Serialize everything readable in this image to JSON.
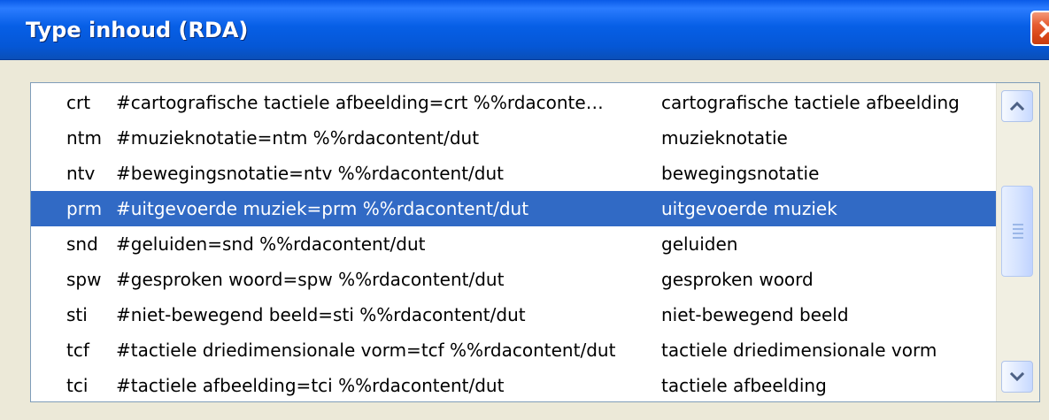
{
  "window": {
    "title": "Type inhoud (RDA)",
    "colors": {
      "titlebar": "#0A5BE8",
      "window_background": "#ECE9D8",
      "list_background": "#FFFFFF",
      "selection": "#316AC5",
      "close_button": "#D94719"
    },
    "icons": {
      "close": "close-icon",
      "scroll_up": "chevron-up-icon",
      "scroll_down": "chevron-down-icon",
      "scroll_grip": "scroll-grip-icon"
    }
  },
  "list": {
    "items": [
      {
        "code": "crt",
        "expression": "#cartografische tactiele afbeelding=crt %%rdaconte…",
        "label": "cartografische tactiele afbeelding",
        "selected": false
      },
      {
        "code": "ntm",
        "expression": "#muzieknotatie=ntm %%rdacontent/dut",
        "label": "muzieknotatie",
        "selected": false
      },
      {
        "code": "ntv",
        "expression": "#bewegingsnotatie=ntv %%rdacontent/dut",
        "label": "bewegingsnotatie",
        "selected": false
      },
      {
        "code": "prm",
        "expression": "#uitgevoerde muziek=prm %%rdacontent/dut",
        "label": "uitgevoerde muziek",
        "selected": true
      },
      {
        "code": "snd",
        "expression": "#geluiden=snd %%rdacontent/dut",
        "label": "geluiden",
        "selected": false
      },
      {
        "code": "spw",
        "expression": "#gesproken woord=spw %%rdacontent/dut",
        "label": "gesproken woord",
        "selected": false
      },
      {
        "code": "sti",
        "expression": "#niet-bewegend beeld=sti %%rdacontent/dut",
        "label": "niet-bewegend beeld",
        "selected": false
      },
      {
        "code": "tcf",
        "expression": "#tactiele driedimensionale vorm=tcf %%rdacontent/dut",
        "label": "tactiele driedimensionale vorm",
        "selected": false
      },
      {
        "code": "tci",
        "expression": "#tactiele afbeelding=tci %%rdacontent/dut",
        "label": "tactiele afbeelding",
        "selected": false
      }
    ]
  }
}
